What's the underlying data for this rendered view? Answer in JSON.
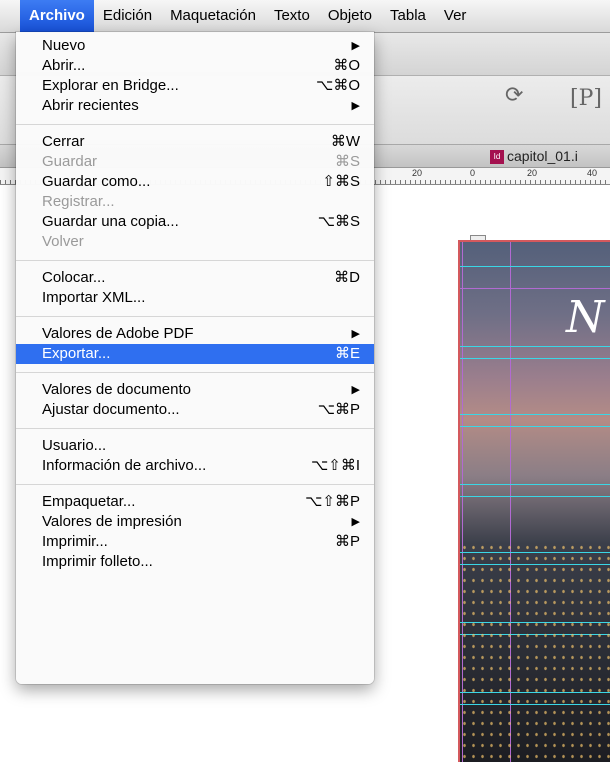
{
  "menubar": {
    "items": [
      "Archivo",
      "Edición",
      "Maquetación",
      "Texto",
      "Objeto",
      "Tabla",
      "Ver"
    ],
    "active_index": 0
  },
  "document": {
    "tab_label": "capitol_01.i",
    "page_title_fragment": "N",
    "ruler_labels": [
      "20",
      "0",
      "20",
      "40"
    ]
  },
  "menu": {
    "groups": [
      [
        {
          "label": "Nuevo",
          "shortcut": "",
          "submenu": true,
          "enabled": true
        },
        {
          "label": "Abrir...",
          "shortcut": "⌘O",
          "submenu": false,
          "enabled": true
        },
        {
          "label": "Explorar en Bridge...",
          "shortcut": "⌥⌘O",
          "submenu": false,
          "enabled": true
        },
        {
          "label": "Abrir recientes",
          "shortcut": "",
          "submenu": true,
          "enabled": true
        }
      ],
      [
        {
          "label": "Cerrar",
          "shortcut": "⌘W",
          "submenu": false,
          "enabled": true
        },
        {
          "label": "Guardar",
          "shortcut": "⌘S",
          "submenu": false,
          "enabled": false
        },
        {
          "label": "Guardar como...",
          "shortcut": "⇧⌘S",
          "submenu": false,
          "enabled": true
        },
        {
          "label": "Registrar...",
          "shortcut": "",
          "submenu": false,
          "enabled": false
        },
        {
          "label": "Guardar una copia...",
          "shortcut": "⌥⌘S",
          "submenu": false,
          "enabled": true
        },
        {
          "label": "Volver",
          "shortcut": "",
          "submenu": false,
          "enabled": false
        }
      ],
      [
        {
          "label": "Colocar...",
          "shortcut": "⌘D",
          "submenu": false,
          "enabled": true
        },
        {
          "label": "Importar XML...",
          "shortcut": "",
          "submenu": false,
          "enabled": true
        }
      ],
      [
        {
          "label": "Valores de Adobe PDF",
          "shortcut": "",
          "submenu": true,
          "enabled": true
        },
        {
          "label": "Exportar...",
          "shortcut": "⌘E",
          "submenu": false,
          "enabled": true,
          "highlighted": true
        }
      ],
      [
        {
          "label": "Valores de documento",
          "shortcut": "",
          "submenu": true,
          "enabled": true
        },
        {
          "label": "Ajustar documento...",
          "shortcut": "⌥⌘P",
          "submenu": false,
          "enabled": true
        }
      ],
      [
        {
          "label": "Usuario...",
          "shortcut": "",
          "submenu": false,
          "enabled": true
        },
        {
          "label": "Información de archivo...",
          "shortcut": "⌥⇧⌘I",
          "submenu": false,
          "enabled": true
        }
      ],
      [
        {
          "label": "Empaquetar...",
          "shortcut": "⌥⇧⌘P",
          "submenu": false,
          "enabled": true
        },
        {
          "label": "Valores de impresión",
          "shortcut": "",
          "submenu": true,
          "enabled": true
        },
        {
          "label": "Imprimir...",
          "shortcut": "⌘P",
          "submenu": false,
          "enabled": true
        },
        {
          "label": "Imprimir folleto...",
          "shortcut": "",
          "submenu": false,
          "enabled": true
        }
      ]
    ]
  },
  "colors": {
    "highlight": "#2f6ff0",
    "guide_cyan": "#3ad7e6",
    "guide_purple": "#b26ad2",
    "bleed_red": "#d4595d"
  }
}
